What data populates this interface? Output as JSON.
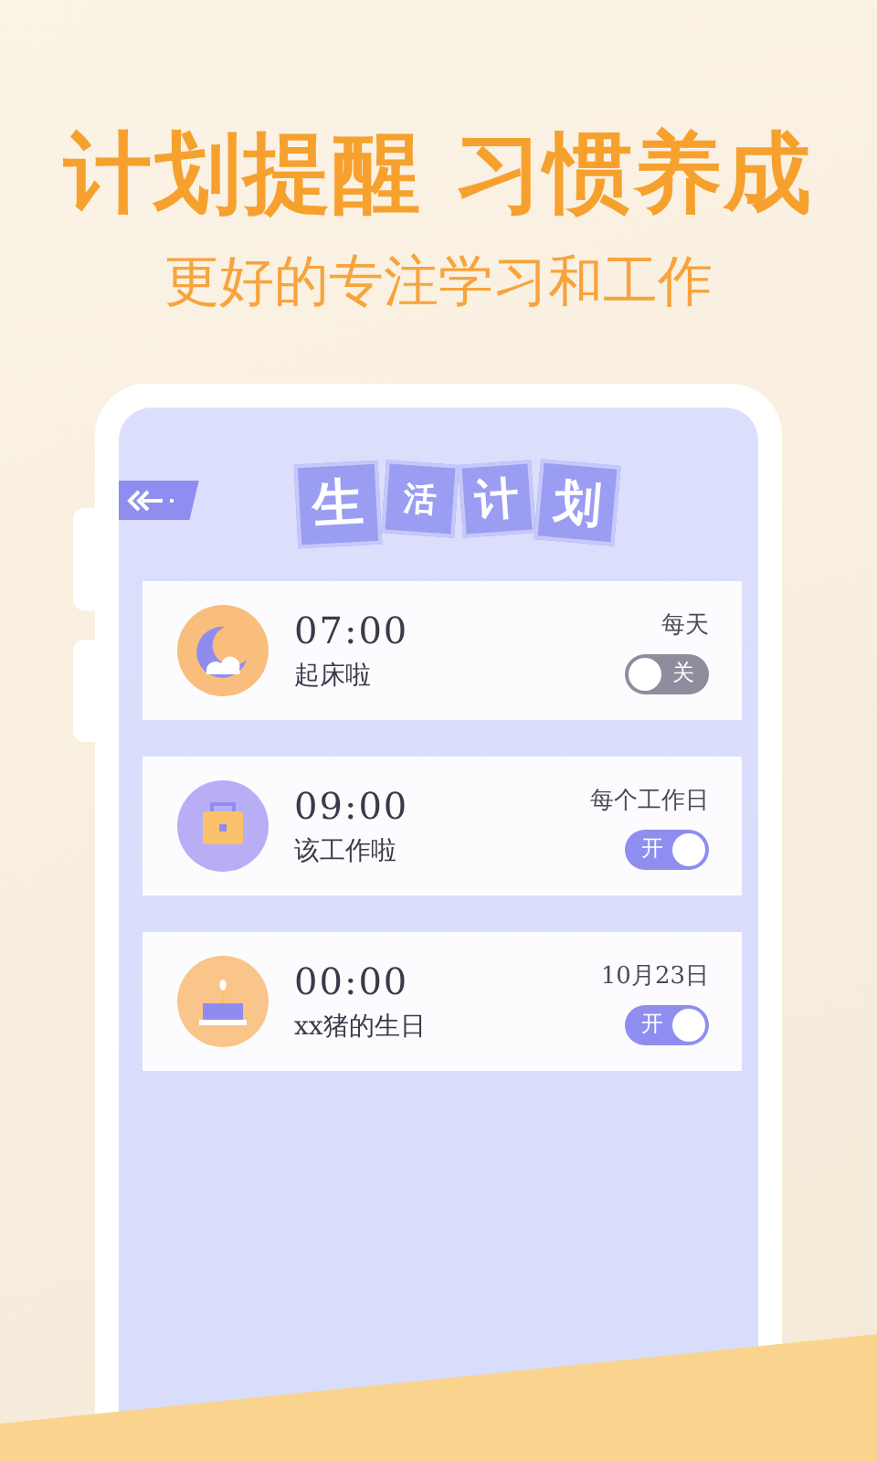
{
  "headline": "计划提醒 习惯养成",
  "subtitle": "更好的专注学习和工作",
  "plan_title": [
    "生",
    "活",
    "计",
    "划"
  ],
  "alarms": [
    {
      "kind": "moon",
      "time": "07:00",
      "label": "起床啦",
      "repeat": "每天",
      "on": false,
      "switch_text": "关"
    },
    {
      "kind": "briefcase",
      "time": "09:00",
      "label": "该工作啦",
      "repeat": "每个工作日",
      "on": true,
      "switch_text": "开"
    },
    {
      "kind": "cake",
      "time": "00:00",
      "label": "xx猪的生日",
      "repeat": "10月23日",
      "on": true,
      "switch_text": "开"
    }
  ]
}
